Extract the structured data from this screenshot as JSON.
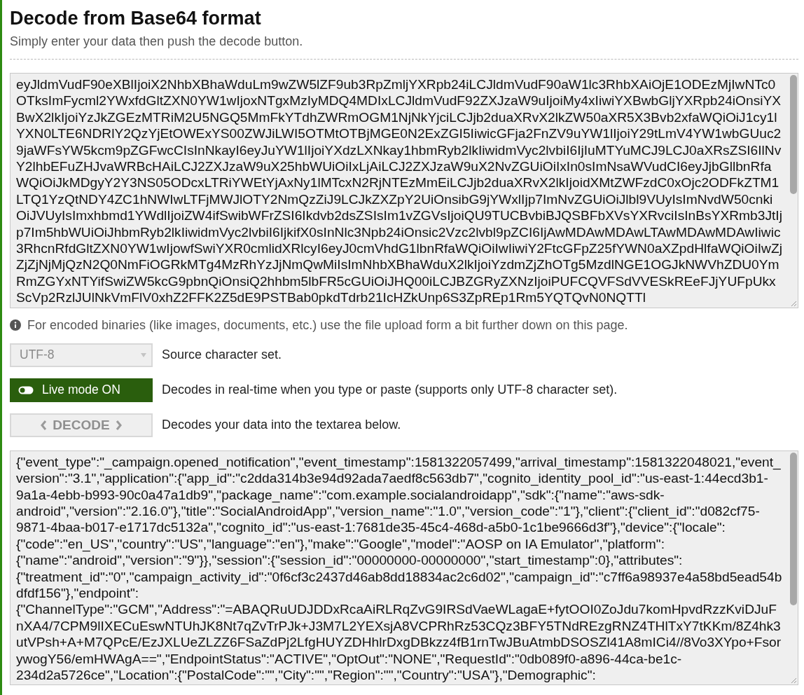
{
  "header": {
    "title": "Decode from Base64 format",
    "subtitle": "Simply enter your data then push the decode button."
  },
  "input_area": {
    "value": "eyJldmVudF90eXBlIjoiX2NhbXBhaWduLm9wZW5lZF9ub3RpZmljYXRpb24iLCJldmVudF90aW1lc3RhbXAiOjE1ODEzMjIwNTc0OTksImFycml2YWxfdGltZXN0YW1wIjoxNTgxMzIyMDQ4MDIxLCJldmVudF92ZXJzaW9uIjoiMy4xIiwiYXBwbGljYXRpb24iOnsiYXBwX2lkIjoiYzJkZGEzMTRiM2U5NGQ5MmFkYTdhZWRmOGM1NjNkYjciLCJjb2duaXRvX2lkZW50aXR5X3Bvb2xfaWQiOiJ1cy1lYXN0LTE6NDRlY2QzYjEtOWExYS00ZWJiLWI5OTMtOTBjMGE0N2ExZGI5IiwicGFja2FnZV9uYW1lIjoiY29tLmV4YW1wbGUuc29jaWFsYW5kcm9pZGFwcCIsInNkayI6eyJuYW1lIjoiYXdzLXNkay1hbmRyb2lkIiwidmVyc2lvbiI6IjIuMTYuMCJ9LCJ0aXRsZSI6IlNvY2lhbEFuZHJvaWRBcHAiLCJ2ZXJzaW9uX25hbWUiOiIxLjAiLCJ2ZXJzaW9uX2NvZGUiOiIxIn0sImNsaWVudCI6eyJjbGllbnRfaWQiOiJkMDgyY2Y3NS05ODcxLTRiYWEtYjAxNy1lMTcxN2RjNTEzMmEiLCJjb2duaXRvX2lkIjoidXMtZWFzdC0xOjc2ODFkZTM1LTQ1YzQtNDY4ZC1hNWIwLTFjMWJlOTY2NmQzZiJ9LCJkZXZpY2UiOnsibG9jYWxlIjp7ImNvZGUiOiJlbl9VUyIsImNvdW50cnkiOiJVUyIsImxhbmd1YWdlIjoiZW4ifSwibWFrZSI6Ikdvb2dsZSIsIm1vZGVsIjoiQU9TUCBvbiBJQSBFbXVsYXRvciIsInBsYXRmb3JtIjp7Im5hbWUiOiJhbmRyb2lkIiwidmVyc2lvbiI6IjkifX0sInNlc3Npb24iOnsic2Vzc2lvbl9pZCI6IjAwMDAwMDAwLTAwMDAwMDAwIiwic3RhcnRfdGltZXN0YW1wIjowfSwiYXR0cmlidXRlcyI6eyJ0cmVhdG1lbnRfaWQiOiIwIiwiY2FtcGFpZ25fYWN0aXZpdHlfaWQiOiIwZjZjZjNjMjQzN2Q0NmFiOGRkMTg4MzRhYzJjNmQwMiIsImNhbXBhaWduX2lkIjoiYzdmZjZhOTg5MzdlNGE1OGJkNWVhZDU0YmRmZGYxNTYifSwiZW5kcG9pbnQiOnsiQ2hhbm5lbFR5cGUiOiJHQ00iLCJBZGRyZXNzIjoiPUFCQVFSdVVESkREeFJjYUFpUkxScVp2RzlJUlNkVmFlV0xhZ2FFK2Z5dE9PSTBab0pkdTdrb21IcHZkUnp6S3ZpREp1Rm5YQTQvN0NQTTl"
  },
  "note": "For encoded binaries (like images, documents, etc.) use the file upload form a bit further down on this page.",
  "options": [
    {
      "kind": "select",
      "value": "UTF-8",
      "disabled": true,
      "description": "Source character set."
    },
    {
      "kind": "toggle",
      "label": "Live mode ON",
      "on": true,
      "description": "Decodes in real-time when you type or paste (supports only UTF-8 character set)."
    },
    {
      "kind": "button",
      "label": "DECODE",
      "disabled": true,
      "description": "Decodes your data into the textarea below."
    }
  ],
  "output_area": {
    "value": "{\"event_type\":\"_campaign.opened_notification\",\"event_timestamp\":1581322057499,\"arrival_timestamp\":1581322048021,\"event_version\":\"3.1\",\"application\":{\"app_id\":\"c2dda314b3e94d92ada7aedf8c563db7\",\"cognito_identity_pool_id\":\"us-east-1:44ecd3b1-9a1a-4ebb-b993-90c0a47a1db9\",\"package_name\":\"com.example.socialandroidapp\",\"sdk\":{\"name\":\"aws-sdk-android\",\"version\":\"2.16.0\"},\"title\":\"SocialAndroidApp\",\"version_name\":\"1.0\",\"version_code\":\"1\"},\"client\":{\"client_id\":\"d082cf75-9871-4baa-b017-e1717dc5132a\",\"cognito_id\":\"us-east-1:7681de35-45c4-468d-a5b0-1c1be9666d3f\"},\"device\":{\"locale\":{\"code\":\"en_US\",\"country\":\"US\",\"language\":\"en\"},\"make\":\"Google\",\"model\":\"AOSP on IA Emulator\",\"platform\":{\"name\":\"android\",\"version\":\"9\"}},\"session\":{\"session_id\":\"00000000-00000000\",\"start_timestamp\":0},\"attributes\":{\"treatment_id\":\"0\",\"campaign_activity_id\":\"0f6cf3c2437d46ab8dd18834ac2c6d02\",\"campaign_id\":\"c7ff6a98937e4a58bd5ead54bdfdf156\"},\"endpoint\":{\"ChannelType\":\"GCM\",\"Address\":\"=ABAQRuUDJDDxRcaAiRLRqZvG9IRSdVaeWLagaE+fytOOI0ZoJdu7komHpvdRzzKviDJuFnXA4/7CPM9lIXECuEswNTUhJK8Nt7qZvTrPJk+J3M7L2YEXsjA8VCPRhRz53CQz3BFY5TNdREzgRNZ4THlTxY7tKKm/8Z4hk3utVPsh+A+M7QPcE/EzJXLUeZLZZ6FSaZdPj2LfgHUYZDHhlrDxgDBkzz4fB1rnTwJBuAtmbDSOSZl41A8mICi4//8Vo3XYpo+FsorywogY56/emHWAgA==\",\"EndpointStatus\":\"ACTIVE\",\"OptOut\":\"NONE\",\"RequestId\":\"0db089f0-a896-44ca-be1c-234d2a5726ce\",\"Location\":{\"PostalCode\":\"\",\"City\":\"\",\"Region\":\"\",\"Country\":\"USA\"},\"Demographic\":"
  }
}
